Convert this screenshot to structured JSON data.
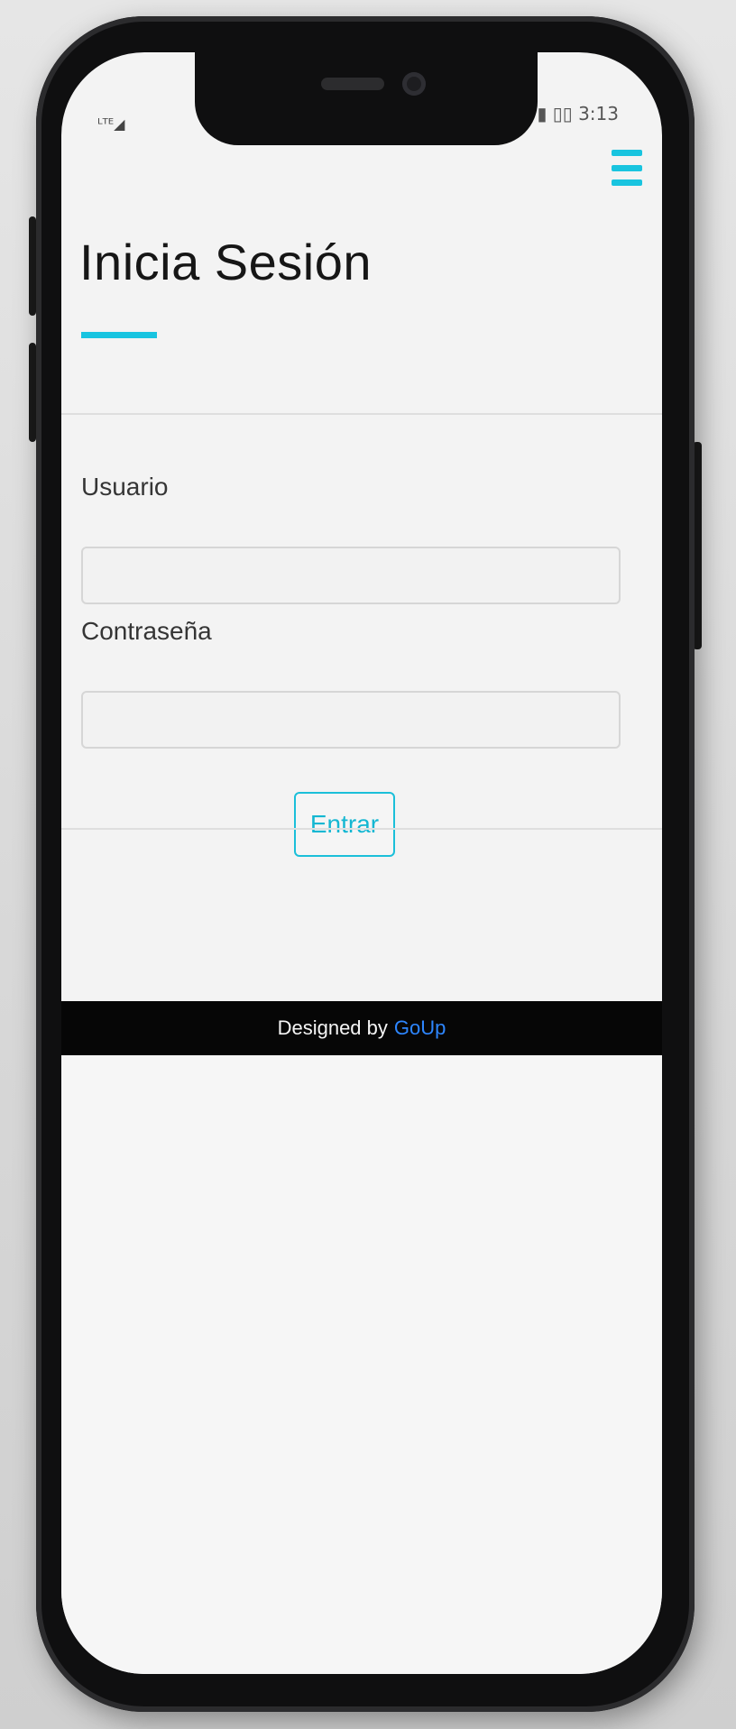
{
  "status_bar": {
    "left_text": "ᴸᵀᴱ◢",
    "right_text": "▮ ▯▯ 3:13"
  },
  "header": {
    "menu_icon": "menu-icon"
  },
  "page": {
    "title": "Inicia Sesión",
    "accent_color": "#19c4df"
  },
  "form": {
    "username_label": "Usuario",
    "username_value": "",
    "password_label": "Contraseña",
    "password_value": "",
    "submit_label": "Entrar"
  },
  "footer": {
    "prefix": "Designed by",
    "brand": "GoUp",
    "brand_color": "#2d86ff"
  }
}
